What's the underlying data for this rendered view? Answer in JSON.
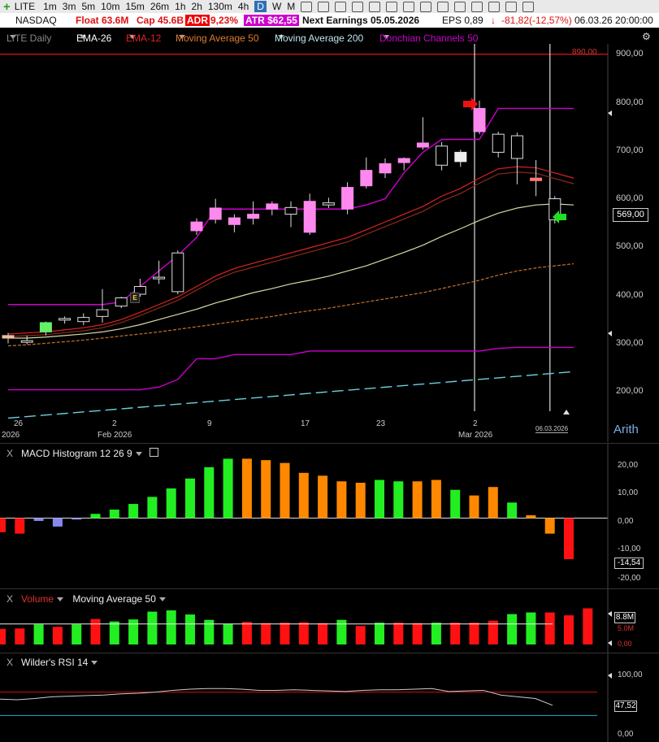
{
  "toolbar": {
    "symbol": "LITE",
    "timeframes": [
      "1m",
      "3m",
      "5m",
      "10m",
      "15m",
      "26m",
      "1h",
      "2h",
      "130m",
      "4h",
      "D",
      "W",
      "M"
    ],
    "active_timeframe": "D"
  },
  "info": {
    "exchange": "NASDAQ",
    "float": "Float 63.6M",
    "cap": "Cap 45.6B",
    "adr_label": "ADR",
    "adr_value": "9,23%",
    "atr": "ATR $62,55",
    "next_earnings": "Next Earnings 05.05.2026",
    "eps": "EPS 0,89",
    "change": "-81,82(-12,57%)",
    "datetime": "06.03.26 20:00:00"
  },
  "studies": {
    "symbol_daily": "LITE Daily",
    "ema26": "EMA-26",
    "ema12": "EMA-12",
    "ma50": "Moving Average 50",
    "ma200": "Moving Average 200",
    "donchian": "Donchian Channels 50"
  },
  "price_axis": {
    "ticks": [
      "900,00",
      "800,00",
      "700,00",
      "600,00",
      "500,00",
      "400,00",
      "300,00",
      "200,00"
    ],
    "hline_label": "890,00",
    "last_price": "569,00",
    "scale_mode": "Arith"
  },
  "date_axis": {
    "ticks": [
      "26",
      "2",
      "9",
      "17",
      "23",
      "2"
    ],
    "sublabels": [
      "2026",
      "Feb 2026",
      "Mar 2026"
    ],
    "cursor_date": "06.03.2026"
  },
  "earnings_marker": "E",
  "macd": {
    "title": "MACD Histogram 12 26 9",
    "ticks": [
      "20,00",
      "10,00",
      "0,00",
      "-10,00",
      "-20,00"
    ],
    "last_value": "-14,54"
  },
  "volume": {
    "title": "Volume",
    "ma_title": "Moving Average 50",
    "labels": [
      "8.8M",
      "5.0M",
      "0,00"
    ]
  },
  "rsi": {
    "title": "Wilder's RSI 14",
    "ticks": [
      "100,00",
      "0,00"
    ],
    "last_value": "47,52"
  },
  "colors": {
    "up": "#33ff33",
    "down": "#ff1111",
    "macd_falling": "#ff8800",
    "donchian": "#cc00cc",
    "ema12": "#dd2222",
    "ema26": "#8b2a1a",
    "ma50": "#d8d8a8",
    "ma200": "#c8702a",
    "marker_red": "#ee1111",
    "marker_green": "#22dd22"
  },
  "chart_data": {
    "type": "candlestick",
    "candles": [
      {
        "o": 340,
        "h": 350,
        "l": 330,
        "c": 345,
        "t": "up"
      },
      {
        "o": 332,
        "h": 345,
        "l": 328,
        "c": 335,
        "t": "neutral"
      },
      {
        "o": 352,
        "h": 372,
        "l": 345,
        "c": 370,
        "t": "green"
      },
      {
        "o": 375,
        "h": 382,
        "l": 368,
        "c": 378,
        "t": "neutral"
      },
      {
        "o": 372,
        "h": 388,
        "l": 365,
        "c": 380,
        "t": "neutral"
      },
      {
        "o": 382,
        "h": 435,
        "l": 370,
        "c": 395,
        "t": "neutral"
      },
      {
        "o": 402,
        "h": 420,
        "l": 398,
        "c": 418,
        "t": "neutral"
      },
      {
        "o": 425,
        "h": 455,
        "l": 420,
        "c": 440,
        "t": "neutral"
      },
      {
        "o": 455,
        "h": 490,
        "l": 445,
        "c": 458,
        "t": "neutral"
      },
      {
        "o": 430,
        "h": 510,
        "l": 425,
        "c": 505,
        "t": "neutral"
      },
      {
        "o": 548,
        "h": 572,
        "l": 540,
        "c": 565,
        "t": "pink"
      },
      {
        "o": 570,
        "h": 610,
        "l": 562,
        "c": 592,
        "t": "pink"
      },
      {
        "o": 560,
        "h": 580,
        "l": 545,
        "c": 573,
        "t": "pink"
      },
      {
        "o": 572,
        "h": 605,
        "l": 560,
        "c": 580,
        "t": "pink"
      },
      {
        "o": 590,
        "h": 605,
        "l": 578,
        "c": 600,
        "t": "pink"
      },
      {
        "o": 580,
        "h": 605,
        "l": 555,
        "c": 593,
        "t": "neutral"
      },
      {
        "o": 545,
        "h": 620,
        "l": 540,
        "c": 605,
        "t": "pink"
      },
      {
        "o": 598,
        "h": 612,
        "l": 592,
        "c": 602,
        "t": "neutral"
      },
      {
        "o": 590,
        "h": 642,
        "l": 580,
        "c": 632,
        "t": "pink"
      },
      {
        "o": 635,
        "h": 690,
        "l": 630,
        "c": 665,
        "t": "pink"
      },
      {
        "o": 660,
        "h": 688,
        "l": 650,
        "c": 678,
        "t": "pink"
      },
      {
        "o": 680,
        "h": 690,
        "l": 665,
        "c": 688,
        "t": "pink"
      },
      {
        "o": 710,
        "h": 768,
        "l": 705,
        "c": 718,
        "t": "pink"
      },
      {
        "o": 675,
        "h": 720,
        "l": 665,
        "c": 712,
        "t": "neutral"
      },
      {
        "o": 700,
        "h": 705,
        "l": 672,
        "c": 682,
        "t": "solidwhite"
      },
      {
        "o": 740,
        "h": 800,
        "l": 735,
        "c": 785,
        "t": "pink"
      },
      {
        "o": 700,
        "h": 740,
        "l": 690,
        "c": 735,
        "t": "neutral"
      },
      {
        "o": 688,
        "h": 738,
        "l": 638,
        "c": 732,
        "t": "neutral"
      },
      {
        "o": 645,
        "h": 685,
        "l": 615,
        "c": 650,
        "t": "red"
      },
      {
        "o": 610,
        "h": 615,
        "l": 562,
        "c": 569,
        "t": "neutral"
      }
    ],
    "hline": 890,
    "macd_hist": [
      -5,
      -5.5,
      -1,
      -3,
      -0.5,
      1.5,
      3,
      5,
      7.5,
      10.5,
      14,
      18,
      21,
      21,
      20.5,
      19.5,
      16,
      15,
      13,
      12.5,
      13.5,
      13,
      13,
      13.5,
      10,
      8,
      11,
      5.5,
      1,
      -5.5,
      -14.54
    ],
    "macd_colors": [
      "red",
      "red",
      "blue",
      "blue",
      "blue",
      "green",
      "green",
      "green",
      "green",
      "green",
      "green",
      "green",
      "green",
      "orange",
      "orange",
      "orange",
      "orange",
      "orange",
      "orange",
      "orange",
      "green",
      "green",
      "orange",
      "orange",
      "green",
      "orange",
      "orange",
      "green",
      "orange",
      "orange",
      "red",
      "red"
    ],
    "volume": [
      3.8,
      3.9,
      4.9,
      4.3,
      4.9,
      6.2,
      5.6,
      6.1,
      8.0,
      8.3,
      7.3,
      6.0,
      5.0,
      5.5,
      5.2,
      5.3,
      5.4,
      5.2,
      6.0,
      4.5,
      5.3,
      5.3,
      5.2,
      5.3,
      5.3,
      5.3,
      5.8,
      7.4,
      7.8,
      7.8,
      7.1,
      8.8
    ],
    "volume_colors": [
      "red",
      "red",
      "green",
      "red",
      "green",
      "red",
      "green",
      "green",
      "green",
      "green",
      "green",
      "green",
      "green",
      "red",
      "red",
      "red",
      "red",
      "red",
      "green",
      "red",
      "green",
      "red",
      "red",
      "green",
      "red",
      "red",
      "red",
      "green",
      "green",
      "red",
      "red",
      "red"
    ],
    "rsi": [
      58,
      57,
      59,
      62,
      63,
      64,
      65,
      67,
      68,
      70,
      73,
      75,
      76,
      76,
      75,
      73,
      73,
      74,
      73,
      72,
      71,
      73,
      74,
      74,
      75,
      76,
      71,
      72,
      73,
      65,
      62,
      59,
      47.52
    ],
    "ylim_price": [
      170,
      910
    ],
    "ylim_macd": [
      -22,
      24
    ],
    "ylim_rsi": [
      0,
      100
    ]
  }
}
